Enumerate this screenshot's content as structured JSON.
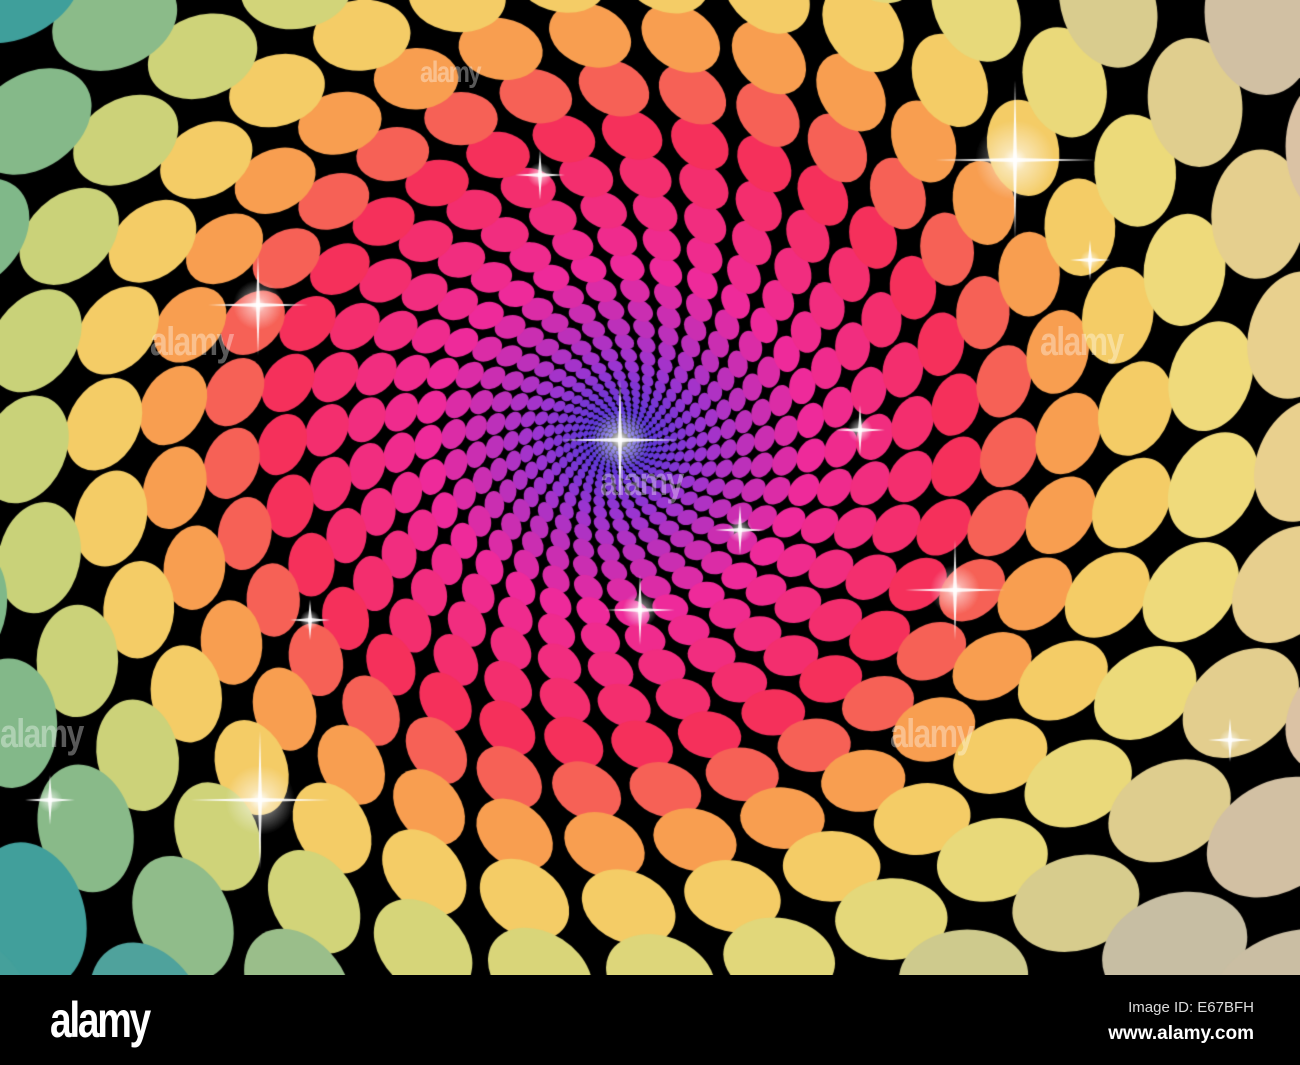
{
  "artwork": {
    "subject": "Abstract disco dots spiral with sparkles",
    "palette": {
      "center": "#3a3ad8",
      "purple": "#9a34d0",
      "magenta": "#ee2a9a",
      "red": "#f5305a",
      "orange": "#f8a050",
      "yellow": "#f2e070",
      "teal": "#2a9a9a",
      "beige": "#e2c4a4",
      "background": "#000000"
    }
  },
  "watermarks": [
    "alamy",
    "alamy",
    "alamy",
    "alamy",
    "alamy",
    "alamy"
  ],
  "footer": {
    "logo": "alamy",
    "image_id": "Image ID: E67BFH",
    "website": "www.alamy.com"
  }
}
